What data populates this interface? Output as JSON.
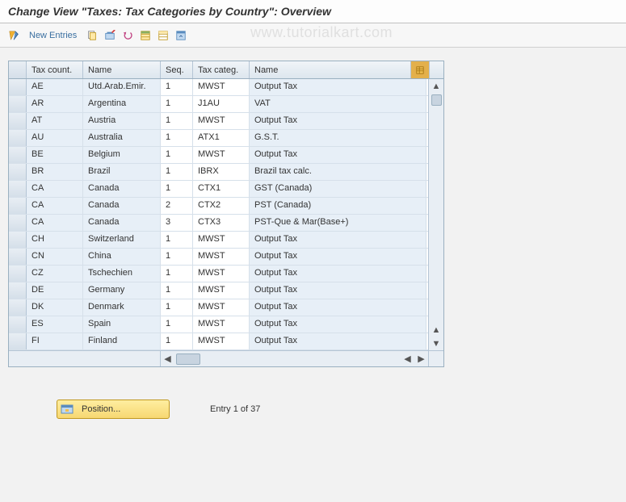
{
  "title": "Change View \"Taxes: Tax Categories by Country\": Overview",
  "watermark": "www.tutorialkart.com",
  "toolbar": {
    "new_entries": "New Entries"
  },
  "columns": {
    "country": "Tax count.",
    "name1": "Name",
    "seq": "Seq.",
    "categ": "Tax categ.",
    "name2": "Name"
  },
  "rows": [
    {
      "country": "AE",
      "name1": "Utd.Arab.Emir.",
      "seq": "1",
      "categ": "MWST",
      "name2": "Output Tax"
    },
    {
      "country": "AR",
      "name1": "Argentina",
      "seq": "1",
      "categ": "J1AU",
      "name2": "VAT"
    },
    {
      "country": "AT",
      "name1": "Austria",
      "seq": "1",
      "categ": "MWST",
      "name2": "Output Tax"
    },
    {
      "country": "AU",
      "name1": "Australia",
      "seq": "1",
      "categ": "ATX1",
      "name2": "G.S.T."
    },
    {
      "country": "BE",
      "name1": "Belgium",
      "seq": "1",
      "categ": "MWST",
      "name2": "Output Tax"
    },
    {
      "country": "BR",
      "name1": "Brazil",
      "seq": "1",
      "categ": "IBRX",
      "name2": "Brazil tax calc."
    },
    {
      "country": "CA",
      "name1": "Canada",
      "seq": "1",
      "categ": "CTX1",
      "name2": "GST (Canada)"
    },
    {
      "country": "CA",
      "name1": "Canada",
      "seq": "2",
      "categ": "CTX2",
      "name2": "PST (Canada)"
    },
    {
      "country": "CA",
      "name1": "Canada",
      "seq": "3",
      "categ": "CTX3",
      "name2": "PST-Que & Mar(Base+)"
    },
    {
      "country": "CH",
      "name1": "Switzerland",
      "seq": "1",
      "categ": "MWST",
      "name2": "Output Tax"
    },
    {
      "country": "CN",
      "name1": "China",
      "seq": "1",
      "categ": "MWST",
      "name2": "Output Tax"
    },
    {
      "country": "CZ",
      "name1": "Tschechien",
      "seq": "1",
      "categ": "MWST",
      "name2": "Output Tax"
    },
    {
      "country": "DE",
      "name1": "Germany",
      "seq": "1",
      "categ": "MWST",
      "name2": "Output Tax"
    },
    {
      "country": "DK",
      "name1": "Denmark",
      "seq": "1",
      "categ": "MWST",
      "name2": "Output Tax"
    },
    {
      "country": "ES",
      "name1": "Spain",
      "seq": "1",
      "categ": "MWST",
      "name2": "Output Tax"
    },
    {
      "country": "FI",
      "name1": "Finland",
      "seq": "1",
      "categ": "MWST",
      "name2": "Output Tax"
    }
  ],
  "footer": {
    "position_btn": "Position...",
    "entry_text": "Entry 1 of 37"
  }
}
